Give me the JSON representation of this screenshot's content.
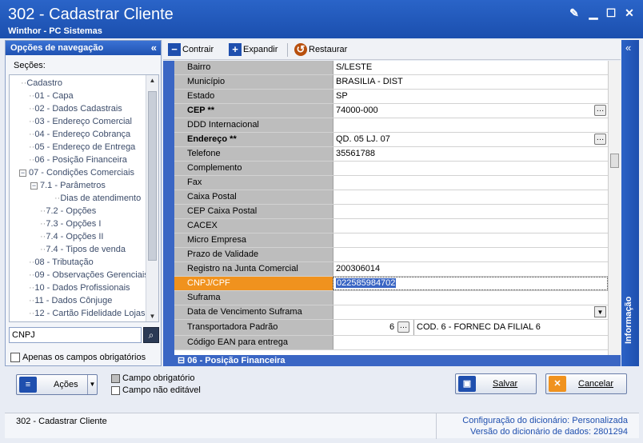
{
  "window": {
    "title": "302 - Cadastrar Cliente",
    "subtitle": "Winthor - PC Sistemas"
  },
  "nav": {
    "header": "Opções de navegação",
    "sections_label": "Seções:",
    "tree": [
      {
        "label": "Cadastro",
        "level": 0
      },
      {
        "label": "01 - Capa",
        "level": 1
      },
      {
        "label": "02 - Dados Cadastrais",
        "level": 1
      },
      {
        "label": "03 - Endereço Comercial",
        "level": 1
      },
      {
        "label": "04 - Endereço Cobrança",
        "level": 1
      },
      {
        "label": "05 - Endereço de Entrega",
        "level": 1
      },
      {
        "label": "06 - Posição Financeira",
        "level": 1
      },
      {
        "label": "07 - Condições Comerciais",
        "level": 1,
        "expander": "−"
      },
      {
        "label": "7.1 - Parâmetros",
        "level": 2,
        "expander": "−"
      },
      {
        "label": "Dias de atendimento",
        "level": 3
      },
      {
        "label": "7.2 - Opções",
        "level": 2
      },
      {
        "label": "7.3 - Opções I",
        "level": 2
      },
      {
        "label": "7.4 - Opções II",
        "level": 2
      },
      {
        "label": "7.4 - Tipos de venda",
        "level": 2
      },
      {
        "label": "08 - Tributação",
        "level": 1
      },
      {
        "label": "09 - Observações Gerenciais",
        "level": 1
      },
      {
        "label": "10 - Dados Profissionais",
        "level": 1
      },
      {
        "label": "11 - Dados Cônjuge",
        "level": 1
      },
      {
        "label": "12 - Cartão Fidelidade Lojas",
        "level": 1
      }
    ],
    "search_value": "CNPJ",
    "only_required_label": "Apenas os campos obrigatórios"
  },
  "toolbar": {
    "collapse": "Contrair",
    "expand": "Expandir",
    "restore": "Restaurar"
  },
  "fields": [
    {
      "label": "Bairro",
      "value": "S/LESTE"
    },
    {
      "label": "Município",
      "value": "BRASILIA - DIST"
    },
    {
      "label": "Estado",
      "value": "SP"
    },
    {
      "label": "CEP **",
      "value": "74000-000",
      "bold": true,
      "ellipsis": true
    },
    {
      "label": "DDD Internacional",
      "value": ""
    },
    {
      "label": "Endereço **",
      "value": "QD. 05 LJ. 07",
      "bold": true,
      "ellipsis": true
    },
    {
      "label": "Telefone",
      "value": "35561788"
    },
    {
      "label": "Complemento",
      "value": ""
    },
    {
      "label": "Fax",
      "value": ""
    },
    {
      "label": "Caixa Postal",
      "value": ""
    },
    {
      "label": "CEP Caixa Postal",
      "value": ""
    },
    {
      "label": "CACEX",
      "value": ""
    },
    {
      "label": "Micro Empresa",
      "value": ""
    },
    {
      "label": "Prazo de Validade",
      "value": ""
    },
    {
      "label": "Registro na Junta Comercial",
      "value": "200306014"
    },
    {
      "label": "CNPJ/CPF",
      "value": "022585984702",
      "selected": true
    },
    {
      "label": "Suframa",
      "value": ""
    },
    {
      "label": "Data de Vencimento Suframa",
      "value": "",
      "dropdown": true
    },
    {
      "label": "Transportadora Padrão",
      "value": "",
      "transport": {
        "code": "6",
        "desc": "COD. 6 - FORNEC DA FILIAL 6"
      }
    },
    {
      "label": "Código EAN para entrega",
      "value": ""
    }
  ],
  "next_section": "06 - Posição Financeira",
  "info_tab": "Informação",
  "bottom": {
    "actions": "Ações",
    "legend_required": "Campo obrigatório",
    "legend_not_editable": "Campo não editável",
    "save": "Salvar",
    "cancel": "Cancelar"
  },
  "status": {
    "left": "302 - Cadastrar Cliente",
    "dict_config_label": "Configuração do dicionário:",
    "dict_config_value": "Personalizada",
    "dict_version_label": "Versão do dicionário de dados:",
    "dict_version_value": "2801294"
  },
  "colors": {
    "title_blue": "#1b4fae",
    "selected_label": "#f0921e",
    "grid_label_gray": "#bdbdbd"
  }
}
